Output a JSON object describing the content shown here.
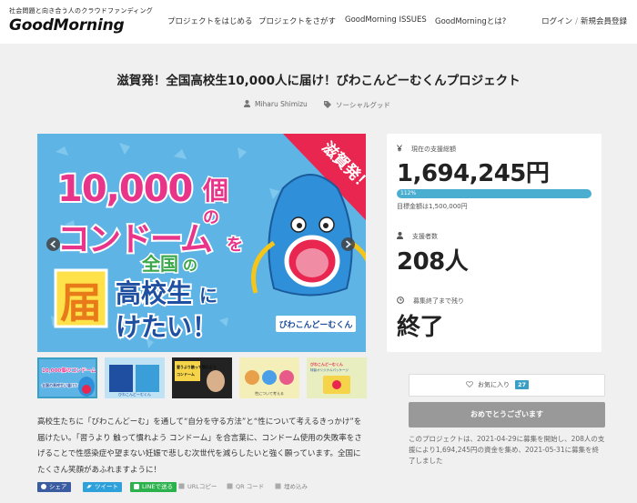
{
  "header": {
    "tagline": "社会問題と向き合う人のクラウドファンディング",
    "logo": "GoodMorning",
    "nav": [
      "プロジェクトをはじめる",
      "プロジェクトをさがす",
      "GoodMorning ISSUES",
      "GoodMorningとは?"
    ],
    "login": "ログイン",
    "divider": "/",
    "signup": "新規会員登録"
  },
  "project": {
    "title": "滋賀発！全国高校生10,000人に届け！びわこんどーむくんプロジェクト",
    "author": "Miharu Shimizu",
    "category": "ソーシャルグッド"
  },
  "hero": {
    "banner": "滋賀発！",
    "line1": "10,000",
    "ko": "個",
    "no": "の",
    "condom": "コンドーム",
    "wo": "を",
    "zenkoku": "全国",
    "no2": "の",
    "koukousei": "高校生",
    "ni": "に",
    "todoke": "届",
    "kemasu": "けたい！",
    "mascot": "びわこんどーむくん"
  },
  "thumbs": [
    {
      "title": "10,000個のコンドーム",
      "caption": "全国の高校生に届けたい！"
    },
    {
      "title": "びわこんどーむくん",
      "caption": ""
    },
    {
      "title": "習うより触って慣れよう",
      "caption": "コンドーム"
    },
    {
      "title": "性について考える",
      "caption": ""
    },
    {
      "title": "びわこんどーむくん",
      "caption": "特製オリジナルパッケージ"
    }
  ],
  "description": "高校生たちに「びわこんどーむ」を通して“自分を守る方法”と“性について考えるきっかけ”を届けたい。「習うより 触って慣れよう コンドーム」を合言葉に、コンドーム使用の失敗率をさげることで性感染症や望まない妊娠で悲しむ次世代を減らしたいと強く願っています。全国にたくさん笑顔があふれますように！",
  "share": {
    "facebook": "シェア",
    "twitter": "ツイート",
    "line": "LINEで送る",
    "url": "URLコピー",
    "qr": "QR コード",
    "embed": "埋め込み"
  },
  "stats": {
    "amount_label": "現在の支援総額",
    "amount": "1,694,245円",
    "percent_label": "112%",
    "percent": 112,
    "goal": "目標金額は1,500,000円",
    "backers_label": "支援者数",
    "backers": "208人",
    "remaining_label": "募集終了まで残り",
    "remaining": "終了"
  },
  "favorite": {
    "label": "お気に入り",
    "count": "27"
  },
  "done_button": "おめでとうございます",
  "note": "このプロジェクトは、2021-04-29に募集を開始し、208人の支援により1,694,245円の資金を集め、2021-05-31に募集を終了しました",
  "colors": {
    "accent": "#4aaed0",
    "facebook": "#3b5ca0",
    "twitter": "#2fa1da",
    "line": "#2bb24c",
    "hero_sky": "#5fb4e6",
    "banner_red": "#e8264f"
  }
}
